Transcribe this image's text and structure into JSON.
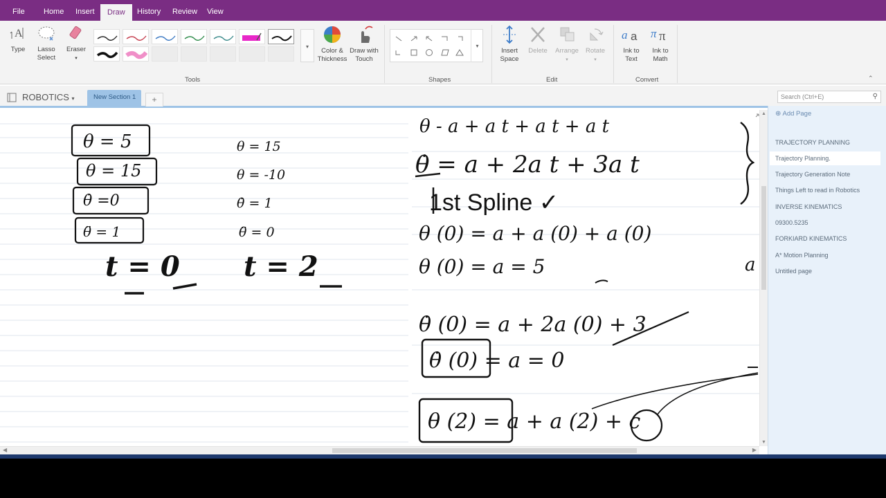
{
  "tabs": [
    "File",
    "Home",
    "Insert",
    "Draw",
    "History",
    "Review",
    "View"
  ],
  "active_tab": "Draw",
  "ribbon": {
    "type_label": "Type",
    "lasso_label": [
      "Lasso",
      "Select"
    ],
    "eraser_label": "Eraser",
    "color_label": [
      "Color &",
      "Thickness"
    ],
    "draw_touch_label": [
      "Draw with",
      "Touch"
    ],
    "insert_space_label": [
      "Insert",
      "Space"
    ],
    "delete_label": "Delete",
    "arrange_label": "Arrange",
    "rotate_label": "Rotate",
    "ink_text_label": [
      "Ink to",
      "Text"
    ],
    "ink_math_label": [
      "Ink to",
      "Math"
    ],
    "group_tools": "Tools",
    "group_shapes": "Shapes",
    "group_edit": "Edit",
    "group_convert": "Convert"
  },
  "notebook": {
    "name": "ROBOTICS",
    "section": "New Section 1",
    "add_section": "+",
    "search_placeholder": "Search (Ctrl+E)"
  },
  "pages": {
    "add_page": "Add Page",
    "items": [
      "TRAJECTORY PLANNING",
      "Trajectory Planning.",
      "Trajectory Generation Note",
      "Things Left to read in Robotics",
      "INVERSE KINEMATICS",
      "09300.5235",
      "FORKIARD KINEMATICS",
      "A* Motion Planning",
      "Untitled page"
    ],
    "selected_index": 1
  },
  "colors": {
    "accent": "#7a2d83",
    "pagelist_bg": "#e8f1fa",
    "section_tab": "#9ec3e6",
    "ink": "#111111"
  }
}
